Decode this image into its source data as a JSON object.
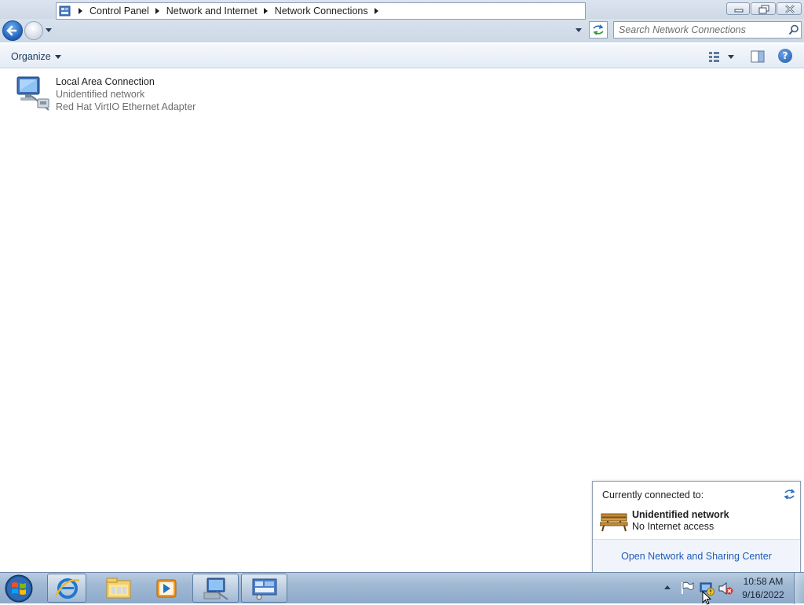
{
  "window": {
    "buttons": {
      "minimize": "minimize-icon",
      "restore": "restore-icon",
      "close": "close-icon"
    }
  },
  "nav": {
    "breadcrumbs": [
      "Control Panel",
      "Network and Internet",
      "Network Connections"
    ],
    "search_placeholder": "Search Network Connections"
  },
  "command_bar": {
    "organize_label": "Organize",
    "help_label": "?"
  },
  "items": [
    {
      "name": "Local Area Connection",
      "status": "Unidentified network",
      "adapter": "Red Hat VirtIO Ethernet Adapter",
      "icon": "network-adapter-icon"
    }
  ],
  "popup": {
    "heading": "Currently connected to:",
    "network_name": "Unidentified network",
    "network_status": "No Internet access",
    "link_label": "Open Network and Sharing Center"
  },
  "taskbar": {
    "pinned": [
      "internet-explorer-icon",
      "windows-explorer-icon",
      "media-player-icon",
      "network-connections-icon",
      "control-panel-icon"
    ],
    "tray": {
      "time": "10:58 AM",
      "date": "9/16/2022"
    }
  },
  "colors": {
    "link": "#1f5bb5",
    "secondary_text": "#6d6d6d",
    "taskbar": "#9fb8d3"
  }
}
